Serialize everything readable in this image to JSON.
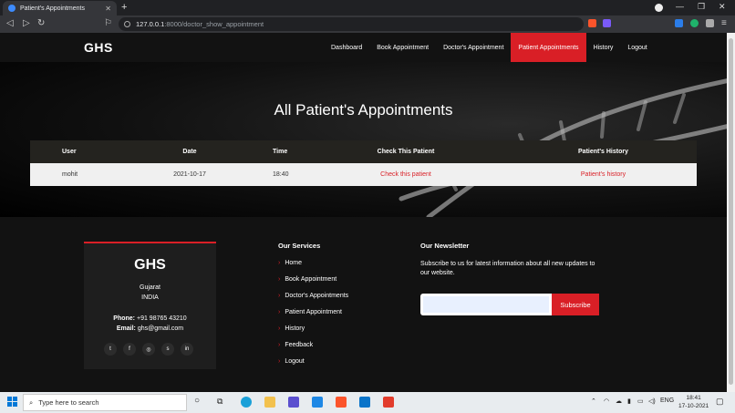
{
  "browser": {
    "tab_title": "Patient's Appointments",
    "url_host": "127.0.0.1",
    "url_path": ":8000/doctor_show_appointment"
  },
  "navbar": {
    "brand": "GHS",
    "items": [
      {
        "label": "Dashboard",
        "active": false
      },
      {
        "label": "Book Appointment",
        "active": false
      },
      {
        "label": "Doctor's Appointment",
        "active": false
      },
      {
        "label": "Patient Appointments",
        "active": true
      },
      {
        "label": "History",
        "active": false
      },
      {
        "label": "Logout",
        "active": false
      }
    ]
  },
  "hero": {
    "title": "All Patient's Appointments"
  },
  "table": {
    "headers": [
      "User",
      "Date",
      "Time",
      "Check This Patient",
      "Patient's History"
    ],
    "rows": [
      {
        "user": "mohit",
        "date": "2021-10-17",
        "time": "18:40",
        "check": "Check this patient",
        "history": "Patient's history"
      }
    ]
  },
  "footer": {
    "card": {
      "title": "GHS",
      "state": "Gujarat",
      "country": "INDIA",
      "phone_label": "Phone:",
      "phone": "+91 98765 43210",
      "email_label": "Email:",
      "email": "ghs@gmail.com",
      "socials": [
        "twitter-icon",
        "facebook-icon",
        "instagram-icon",
        "skype-icon",
        "linkedin-icon"
      ]
    },
    "services": {
      "heading": "Our Services",
      "items": [
        "Home",
        "Book Appointment",
        "Doctor's Appointments",
        "Patient Appointment",
        "History",
        "Feedback",
        "Logout"
      ]
    },
    "newsletter": {
      "heading": "Our Newsletter",
      "text": "Subscribe to us for latest information about all new updates to our website.",
      "input_value": "",
      "button": "Subscribe"
    }
  },
  "taskbar": {
    "search_placeholder": "Type here to search",
    "lang": "ENG",
    "time": "18:41",
    "date": "17-10-2021"
  },
  "colors": {
    "accent": "#d91f26",
    "table_header": "#24231f"
  }
}
